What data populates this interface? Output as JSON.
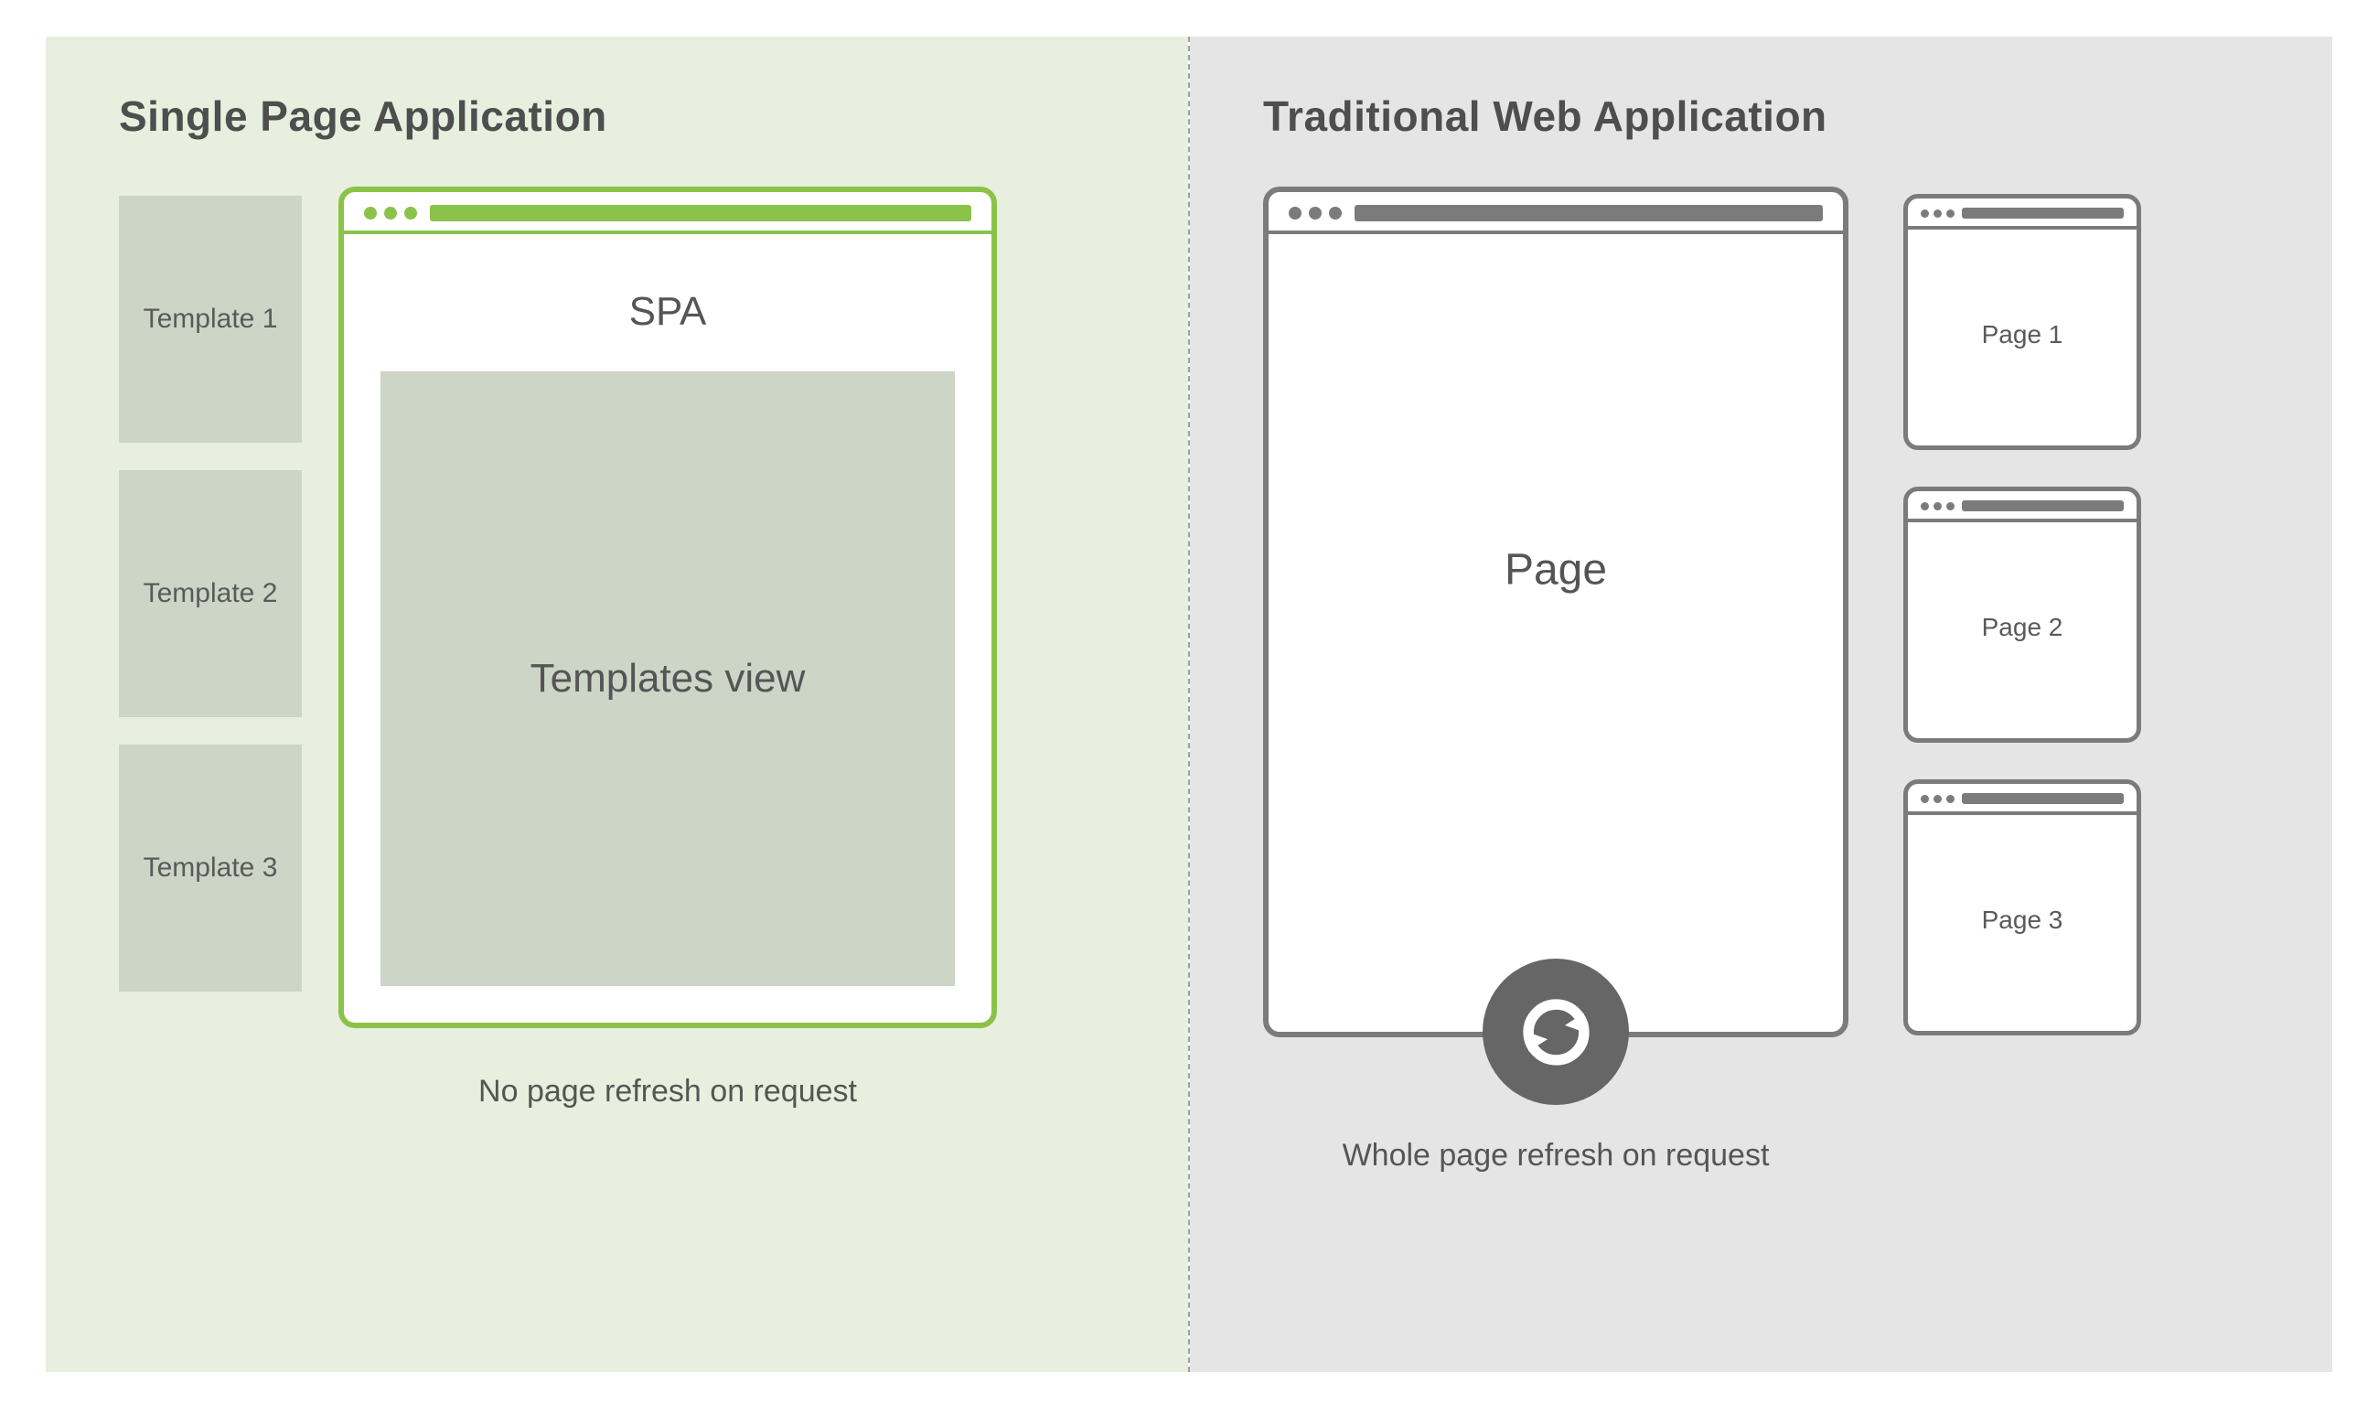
{
  "left": {
    "title": "Single Page Application",
    "templates": [
      "Template 1",
      "Template 2",
      "Template 3"
    ],
    "browser_label": "SPA",
    "templates_view_label": "Templates view",
    "caption": "No page refresh on request"
  },
  "right": {
    "title": "Traditional Web Application",
    "page_label": "Page",
    "pages": [
      "Page 1",
      "Page 2",
      "Page 3"
    ],
    "caption": "Whole page refresh on request"
  },
  "colors": {
    "spa_accent": "#8BC34A",
    "spa_bg": "#e8efde",
    "trad_bg": "#e5e5e5",
    "grey_stroke": "#7b7b7b",
    "refresh_bg": "#666666",
    "tile_bg": "#cdd5c6"
  }
}
